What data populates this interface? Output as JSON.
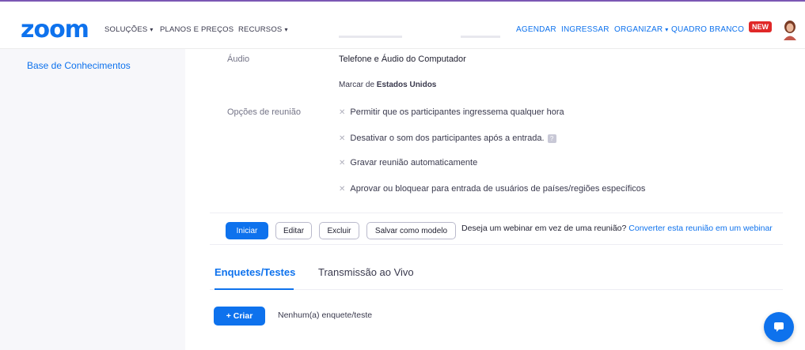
{
  "header": {
    "logo": "zoom",
    "nav_left": [
      {
        "label": "SOLUÇÕES",
        "caret": true
      },
      {
        "label": "PLANOS E PREÇOS",
        "caret": false
      },
      {
        "label": "RECURSOS",
        "caret": true
      }
    ],
    "nav_right": [
      {
        "label": "AGENDAR",
        "caret": false
      },
      {
        "label": "INGRESSAR",
        "caret": false
      },
      {
        "label": "ORGANIZAR",
        "caret": true
      },
      {
        "label": "QUADRO BRANCO",
        "caret": false
      }
    ],
    "badge": "NEW"
  },
  "sidebar": {
    "link": "Base de Conhecimentos"
  },
  "details": {
    "audio_label": "Áudio",
    "audio_value": "Telefone e Áudio do Computador",
    "dial_prefix": "Marcar de ",
    "dial_country": "Estados Unidos",
    "options_label": "Opções de reunião",
    "options": [
      "Permitir que os participantes ingressema qualquer hora",
      "Desativar o som dos participantes após a entrada.",
      "Gravar reunião automaticamente",
      "Aprovar ou bloquear para entrada de usuários de países/regiões específicos"
    ]
  },
  "actions": {
    "start": "Iniciar",
    "edit": "Editar",
    "delete": "Excluir",
    "save_template": "Salvar como modelo",
    "webinar_question": "Deseja um webinar em vez de uma reunião?",
    "webinar_link": "Converter esta reunião em um webinar"
  },
  "tabs": {
    "polls": "Enquetes/Testes",
    "live": "Transmissão ao Vivo"
  },
  "polls": {
    "create": "+ Criar",
    "empty": "Nenhum(a) enquete/teste"
  },
  "colors": {
    "accent": "#0e72ed",
    "badge": "#e02828",
    "frame": "#7b57b4"
  }
}
